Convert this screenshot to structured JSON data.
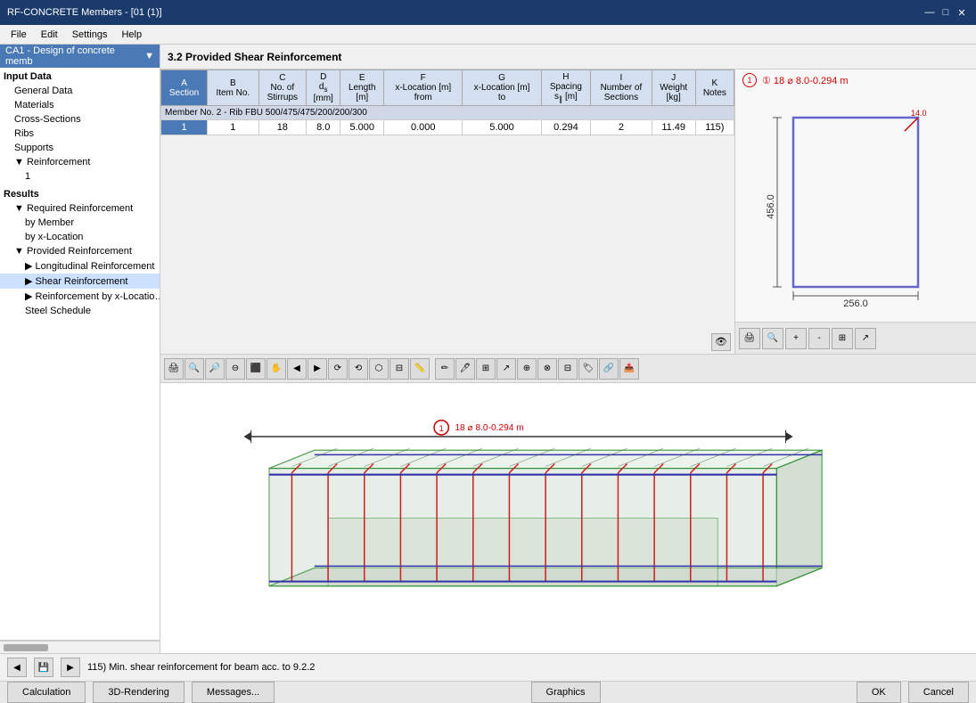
{
  "titleBar": {
    "title": "RF-CONCRETE Members - [01 (1)]",
    "controls": [
      "—",
      "□",
      "✕"
    ]
  },
  "menuBar": {
    "items": [
      "File",
      "Edit",
      "Settings",
      "Help"
    ]
  },
  "sidebar": {
    "dropdown": "CA1 - Design of concrete memb",
    "sections": [
      {
        "label": "Input Data",
        "level": 0,
        "bold": true
      },
      {
        "label": "General Data",
        "level": 1,
        "expander": ""
      },
      {
        "label": "Materials",
        "level": 1,
        "expander": ""
      },
      {
        "label": "Cross-Sections",
        "level": 1,
        "expander": ""
      },
      {
        "label": "Ribs",
        "level": 1,
        "expander": ""
      },
      {
        "label": "Supports",
        "level": 1,
        "expander": ""
      },
      {
        "label": "Reinforcement",
        "level": 1,
        "expander": "▼"
      },
      {
        "label": "1",
        "level": 2,
        "expander": ""
      },
      {
        "label": "Results",
        "level": 0,
        "bold": true
      },
      {
        "label": "Required Reinforcement",
        "level": 1,
        "expander": "▼"
      },
      {
        "label": "by Member",
        "level": 2,
        "expander": ""
      },
      {
        "label": "by x-Location",
        "level": 2,
        "expander": ""
      },
      {
        "label": "Provided Reinforcement",
        "level": 1,
        "expander": "▼"
      },
      {
        "label": "Longitudinal Reinforcement",
        "level": 2,
        "expander": "▶"
      },
      {
        "label": "Shear Reinforcement",
        "level": 2,
        "expander": "▶",
        "selected": true
      },
      {
        "label": "Reinforcement by x-Locatio…",
        "level": 2,
        "expander": "▶"
      },
      {
        "label": "Steel Schedule",
        "level": 2,
        "expander": ""
      }
    ]
  },
  "sectionTitle": "3.2  Provided Shear Reinforcement",
  "table": {
    "columns": [
      {
        "id": "A",
        "label": "A",
        "sub": "Section"
      },
      {
        "id": "B",
        "label": "B",
        "sub": "Item No."
      },
      {
        "id": "C",
        "label": "C",
        "sub": "No. of Stirrups"
      },
      {
        "id": "D",
        "label": "D",
        "sub": "ds [mm]"
      },
      {
        "id": "E",
        "label": "E",
        "sub": "Length [m]"
      },
      {
        "id": "F",
        "label": "F",
        "sub": "x-Location [m] from"
      },
      {
        "id": "G",
        "label": "G",
        "sub": "x-Location [m] to"
      },
      {
        "id": "H",
        "label": "H",
        "sub": "Spacing s∥ [m]"
      },
      {
        "id": "I",
        "label": "I",
        "sub": "Number of Sections"
      },
      {
        "id": "J",
        "label": "J",
        "sub": "Weight [kg]"
      },
      {
        "id": "K",
        "label": "K",
        "sub": "Notes"
      }
    ],
    "memberRow": "Member No. 2 - Rib FBU 500/475/475/200/200/300",
    "rows": [
      {
        "section": "1",
        "item": "1",
        "stirrups": "18",
        "ds": "8.0",
        "length": "5.000",
        "from": "0.000",
        "to": "5.000",
        "spacing": "0.294",
        "sections": "2",
        "weight": "11.49",
        "notes": "115)"
      }
    ]
  },
  "crossSection": {
    "label": "① 18 ⌀ 8.0-0.294 m",
    "width": "256.0",
    "height": "456.0",
    "annotationAngle": "14.0"
  },
  "annotation3d": {
    "label": "① 18 ⌀ 8.0-0.294 m"
  },
  "statusBar": {
    "text": "115) Min. shear reinforcement for beam acc. to 9.2.2"
  },
  "bottomButtons": {
    "calculation": "Calculation",
    "rendering": "3D-Rendering",
    "messages": "Messages...",
    "graphics": "Graphics",
    "ok": "OK",
    "cancel": "Cancel"
  },
  "viewToolbar": {
    "buttons": [
      "⊞",
      "↖",
      "🔍",
      "🔎",
      "⊕",
      "⊖",
      "⬛",
      "⬜",
      "▷",
      "◁",
      "⟳",
      "⟲",
      "⬡",
      "⊟",
      "⊕",
      "—",
      "↗",
      "↙",
      "⊞",
      "⊟",
      "⊕",
      "⊘",
      "⊞"
    ]
  },
  "csToolbar": {
    "buttons": [
      "🖺",
      "🔍",
      "⊕",
      "⊖",
      "⊞",
      "↗"
    ]
  }
}
